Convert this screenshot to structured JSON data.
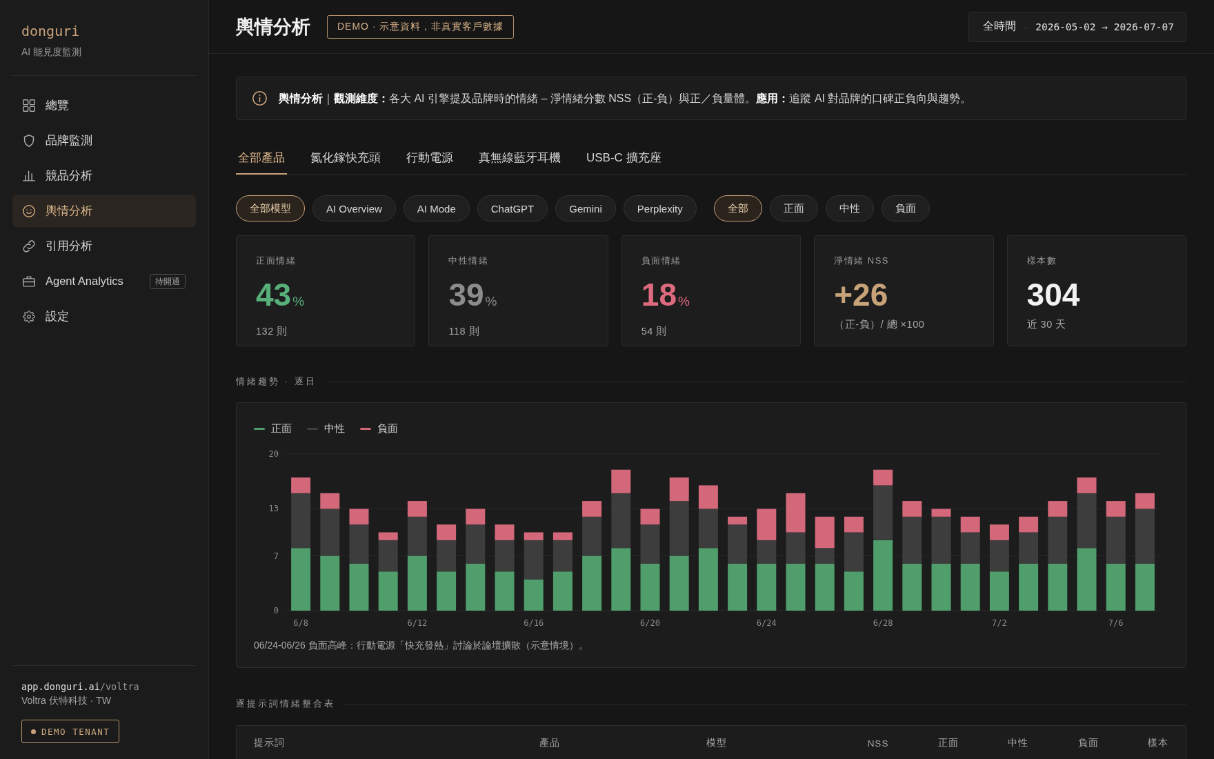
{
  "sidebar": {
    "brand": {
      "name": "donguri",
      "tagline": "AI 能見度監測"
    },
    "items": [
      {
        "label": "總覽",
        "selected": false
      },
      {
        "label": "品牌監測",
        "selected": false
      },
      {
        "label": "競品分析",
        "selected": false
      },
      {
        "label": "輿情分析",
        "selected": true
      },
      {
        "label": "引用分析",
        "selected": false
      },
      {
        "label": "Agent Analytics",
        "selected": false,
        "badge": "待開通"
      },
      {
        "label": "設定",
        "selected": false
      }
    ],
    "footer": {
      "host": "app.donguri.ai",
      "path": "/voltra",
      "org": "Voltra 伏特科技 · TW",
      "tenant_button": "DEMO TENANT"
    }
  },
  "header": {
    "title": "輿情分析",
    "badge": "DEMO · 示意資料，非真實客戶數據",
    "period": {
      "label": "全時間",
      "separator": "·",
      "range": "2026-05-02 → 2026-07-07"
    }
  },
  "info_banner": {
    "text": "**輿情分析**｜**觀測維度：**各大 AI 引擎提及品牌時的情緒 – 淨情緒分數 NSS（正-負）與正／負量體。**應用：**追蹤 AI 對品牌的口碑正負向與趨勢。"
  },
  "product_tabs": [
    {
      "label": "全部產品",
      "selected": true
    },
    {
      "label": "氮化鎵快充頭",
      "selected": false
    },
    {
      "label": "行動電源",
      "selected": false
    },
    {
      "label": "真無線藍牙耳機",
      "selected": false
    },
    {
      "label": "USB-C 擴充座",
      "selected": false
    }
  ],
  "model_filters": [
    {
      "label": "全部模型",
      "selected": true
    },
    {
      "label": "AI Overview",
      "selected": false
    },
    {
      "label": "AI Mode",
      "selected": false
    },
    {
      "label": "ChatGPT",
      "selected": false
    },
    {
      "label": "Gemini",
      "selected": false
    },
    {
      "label": "Perplexity",
      "selected": false
    }
  ],
  "sentiment_filters": [
    {
      "label": "全部",
      "selected": true
    },
    {
      "label": "正面",
      "selected": false
    },
    {
      "label": "中性",
      "selected": false
    },
    {
      "label": "負面",
      "selected": false
    }
  ],
  "stats": [
    {
      "label": "正面情緒",
      "value": "43",
      "unit": "%",
      "note": "132 則",
      "color": "#57b07a"
    },
    {
      "label": "中性情緒",
      "value": "39",
      "unit": "%",
      "note": "118 則",
      "color": "#8c8c8c"
    },
    {
      "label": "負面情緒",
      "value": "18",
      "unit": "%",
      "note": "54 則",
      "color": "#de6a7f"
    },
    {
      "label": "淨情緒 NSS",
      "value": "+26",
      "note": "（正-負）/ 總 ×100",
      "color": "#c8a379"
    },
    {
      "label": "樣本數",
      "value": "304",
      "note": "近 30 天",
      "color": "#f2f2f2"
    }
  ],
  "trend": {
    "title": "情緒趨勢 · 逐日",
    "chart_data": {
      "type": "bar",
      "stacked": true,
      "categories": [
        "6/8",
        null,
        null,
        null,
        "6/12",
        null,
        null,
        null,
        "6/16",
        null,
        null,
        null,
        "6/20",
        null,
        null,
        null,
        "6/24",
        null,
        null,
        null,
        "6/28",
        null,
        null,
        null,
        "7/2",
        null,
        null,
        null,
        "7/6",
        null
      ],
      "ylim": [
        0,
        20
      ],
      "yticks": [
        0,
        7,
        13,
        20
      ],
      "series": [
        {
          "name": "正面",
          "color": "#4f9e6b",
          "values": [
            8,
            7,
            6,
            5,
            7,
            5,
            6,
            5,
            4,
            5,
            7,
            8,
            6,
            7,
            8,
            6,
            6,
            6,
            6,
            5,
            9,
            6,
            6,
            6,
            5,
            6,
            6,
            8,
            6,
            6
          ]
        },
        {
          "name": "中性",
          "color": "#3d3d3d",
          "values": [
            7,
            6,
            5,
            4,
            5,
            4,
            5,
            4,
            5,
            4,
            5,
            7,
            5,
            7,
            5,
            5,
            3,
            4,
            2,
            5,
            7,
            6,
            6,
            4,
            4,
            4,
            6,
            7,
            6,
            7
          ]
        },
        {
          "name": "負面",
          "color": "#d4687b",
          "values": [
            2,
            2,
            2,
            1,
            2,
            2,
            2,
            2,
            1,
            1,
            2,
            3,
            2,
            3,
            3,
            1,
            4,
            5,
            4,
            2,
            2,
            2,
            1,
            2,
            2,
            2,
            2,
            2,
            2,
            2
          ]
        }
      ]
    },
    "note": "06/24-06/26 負面高峰：行動電源「快充發熱」討論於論壇擴散（示意情境）。"
  },
  "table": {
    "title": "逐提示詞情緒整合表",
    "columns": [
      "提示詞",
      "產品",
      "模型",
      "NSS",
      "正面",
      "中性",
      "負面",
      "樣本"
    ]
  }
}
